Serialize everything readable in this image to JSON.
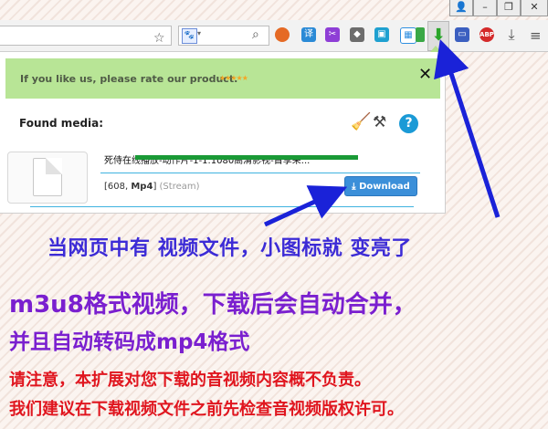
{
  "browser": {
    "window_buttons": [
      "user-icon",
      "minimize-icon",
      "restore-icon",
      "close-icon"
    ],
    "search_engine_icon": "paw-icon",
    "extension_icons": [
      {
        "name": "color-extension-icon",
        "glyph": "●",
        "color": "#e56a25"
      },
      {
        "name": "translate-extension-icon",
        "glyph": "译",
        "color": "#2a8ad6"
      },
      {
        "name": "scissors-extension-icon",
        "glyph": "✂",
        "color": "#8e3ed6"
      },
      {
        "name": "lion-extension-icon",
        "glyph": "◆",
        "color": "#6c6c6c"
      },
      {
        "name": "screenshot-extension-icon",
        "glyph": "▣",
        "color": "#1ea0d0"
      },
      {
        "name": "capture-extension-icon",
        "glyph": "▦",
        "color": "#2f8fe0"
      },
      {
        "name": "google-extension-icon",
        "glyph": "■",
        "color": "#3aa846"
      },
      {
        "name": "download-extension-icon",
        "glyph": "⬇",
        "color": "#2aa52a"
      },
      {
        "name": "screen-extension-icon",
        "glyph": "▭",
        "color": "#3b5fc0"
      },
      {
        "name": "abp-extension-icon",
        "glyph": "ABP",
        "color": "#d42a2a"
      },
      {
        "name": "downloads-icon",
        "glyph": "⤓",
        "color": "#555555"
      },
      {
        "name": "menu-icon",
        "glyph": "≡",
        "color": "#555555"
      }
    ]
  },
  "popup": {
    "rate_message": "If you like us, please rate our product.",
    "rate_stars": "★★★★★",
    "found_media_label": "Found media:",
    "media": {
      "title": "死侍在线播放-动作片-1-1.1080高清影视-首享朵...",
      "meta_prefix": "[608, ",
      "format": "Mp4",
      "meta_suffix": "]",
      "type": "(Stream)",
      "download_label": "Download"
    }
  },
  "annotations": {
    "line1": "当网页中有 视频文件，小图标就 变亮了",
    "line2": "m3u8格式视频，下载后会自动合并，",
    "line3": "并且自动转码成mp4格式",
    "line4": "请注意，本扩展对您下载的音视频内容概不负责。",
    "line5": "我们建议在下载视频文件之前先检查音视频版权许可。"
  },
  "colors": {
    "rate_bar": "#b8e596",
    "download_button": "#3b8fd9",
    "annotation_blue": "#3c2bd6",
    "annotation_purple": "#7a1fcf",
    "annotation_red": "#e0161f",
    "arrow": "#1a22d8"
  }
}
